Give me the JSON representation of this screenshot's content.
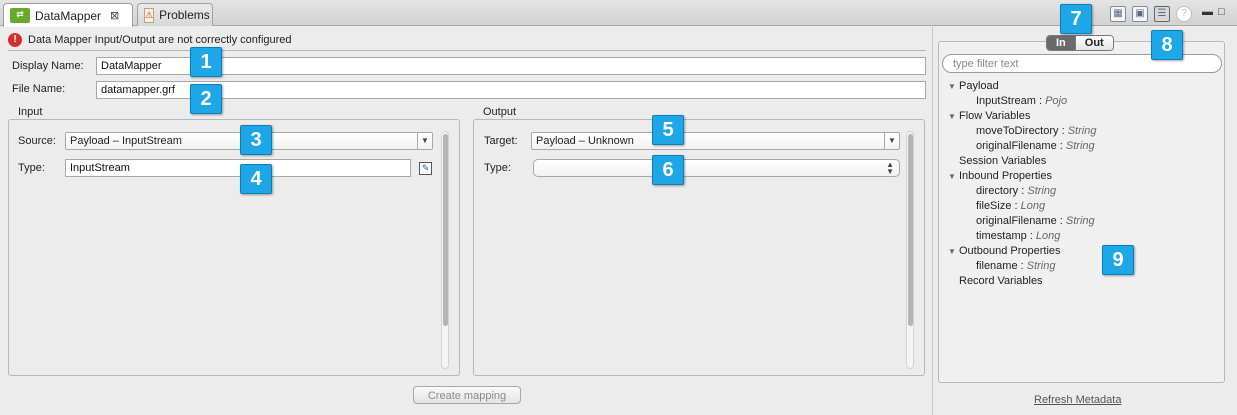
{
  "tabs": {
    "active": {
      "label": "DataMapper",
      "icon": "datamapper-icon",
      "close": "⊠"
    },
    "inactive": {
      "label": "Problems",
      "icon": "problems-icon"
    }
  },
  "toolbar": {
    "icons": [
      "table-icon",
      "save-icon",
      "tree-icon",
      "help-icon",
      "minimize-icon",
      "maximize-icon"
    ],
    "help": "?",
    "minimize": "▬",
    "maximize": "□"
  },
  "error": {
    "icon": "!",
    "message": "Data Mapper Input/Output are not correctly configured"
  },
  "form": {
    "display_name_label": "Display Name:",
    "display_name_value": "DataMapper",
    "file_name_label": "File Name:",
    "file_name_value": "datamapper.grf"
  },
  "input": {
    "group_label": "Input",
    "source_label": "Source:",
    "source_value": "Payload – InputStream",
    "type_label": "Type:",
    "type_value": "InputStream"
  },
  "output": {
    "group_label": "Output",
    "target_label": "Target:",
    "target_value": "Payload – Unknown",
    "type_label": "Type:",
    "type_value": ""
  },
  "create_mapping_label": "Create mapping",
  "metadata": {
    "toggle_in": "In",
    "toggle_out": "Out",
    "filter_placeholder": "type filter text",
    "tree": [
      {
        "level": 0,
        "expanded": true,
        "label": "Payload"
      },
      {
        "level": 1,
        "label": "InputStream",
        "sep": " : ",
        "type": "Pojo"
      },
      {
        "level": 0,
        "expanded": true,
        "label": "Flow Variables"
      },
      {
        "level": 1,
        "label": "moveToDirectory",
        "sep": " : ",
        "type": "String"
      },
      {
        "level": 1,
        "label": "originalFilename",
        "sep": " : ",
        "type": "String"
      },
      {
        "level": 0,
        "expanded": false,
        "label": "Session Variables"
      },
      {
        "level": 0,
        "expanded": true,
        "label": "Inbound Properties"
      },
      {
        "level": 1,
        "label": "directory",
        "sep": " : ",
        "type": "String"
      },
      {
        "level": 1,
        "label": "fileSize",
        "sep": " : ",
        "type": "Long"
      },
      {
        "level": 1,
        "label": "originalFilename",
        "sep": " : ",
        "type": "String"
      },
      {
        "level": 1,
        "label": "timestamp",
        "sep": " : ",
        "type": "Long"
      },
      {
        "level": 0,
        "expanded": true,
        "label": "Outbound Properties"
      },
      {
        "level": 1,
        "label": "filename",
        "sep": " : ",
        "type": "String"
      },
      {
        "level": 0,
        "expanded": false,
        "label": "Record Variables"
      }
    ],
    "refresh_label": "Refresh Metadata"
  },
  "callouts": [
    "1",
    "2",
    "3",
    "4",
    "5",
    "6",
    "7",
    "8",
    "9"
  ],
  "colors": {
    "callout": "#1ea7e8",
    "error": "#d32f2f",
    "datamapper_icon": "#6aaa2a"
  }
}
